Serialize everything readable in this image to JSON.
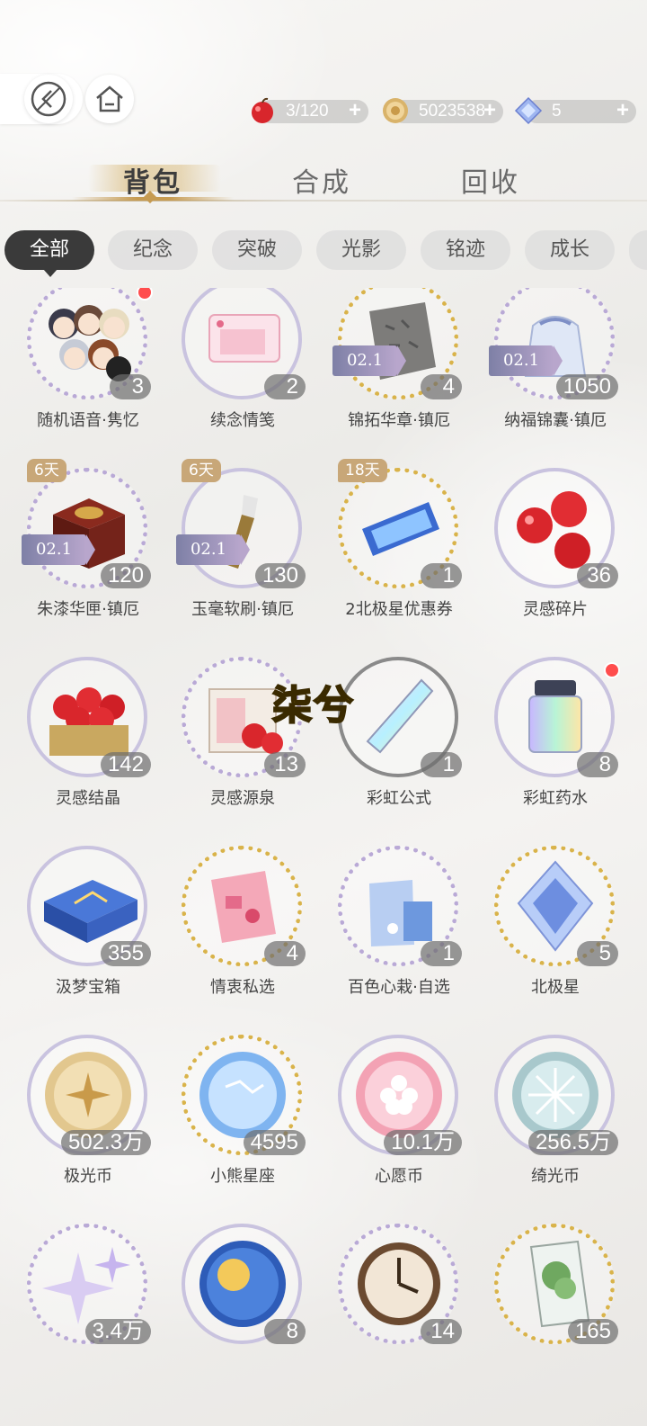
{
  "resources": {
    "apple": {
      "value": "3/120",
      "icon": "apple-icon"
    },
    "coin": {
      "value": "5023538",
      "icon": "coin-icon"
    },
    "gem": {
      "value": "5",
      "icon": "diamond-icon"
    }
  },
  "tabs": {
    "bag": "背包",
    "compose": "合成",
    "recycle": "回收"
  },
  "categories": [
    "全部",
    "纪念",
    "突破",
    "光影",
    "铭迹",
    "成长"
  ],
  "overlay_text": "柒兮",
  "ticket_label": "02.1",
  "items": [
    {
      "name": "随机语音·隽忆",
      "count": "3"
    },
    {
      "name": "续念情笺",
      "count": "2"
    },
    {
      "name": "锦拓华章·镇厄",
      "count": "4"
    },
    {
      "name": "纳福锦囊·镇厄",
      "count": "1050"
    },
    {
      "name": "朱漆华匣·镇厄",
      "count": "120",
      "days": "6天"
    },
    {
      "name": "玉毫软刷·镇厄",
      "count": "130",
      "days": "6天"
    },
    {
      "name": "2北极星优惠券",
      "count": "1",
      "days": "18天"
    },
    {
      "name": "灵感碎片",
      "count": "36"
    },
    {
      "name": "灵感结晶",
      "count": "142"
    },
    {
      "name": "灵感源泉",
      "count": "13"
    },
    {
      "name": "彩虹公式",
      "count": "1"
    },
    {
      "name": "彩虹药水",
      "count": "8"
    },
    {
      "name": "汲梦宝箱",
      "count": "355"
    },
    {
      "name": "情衷私选",
      "count": "4"
    },
    {
      "name": "百色心栽·自选",
      "count": "1"
    },
    {
      "name": "北极星",
      "count": "5"
    },
    {
      "name": "极光币",
      "count": "502.3万"
    },
    {
      "name": "小熊星座",
      "count": "4595"
    },
    {
      "name": "心愿币",
      "count": "10.1万"
    },
    {
      "name": "绮光币",
      "count": "256.5万"
    },
    {
      "name": "",
      "count": "3.4万"
    },
    {
      "name": "",
      "count": "8"
    },
    {
      "name": "",
      "count": "14"
    },
    {
      "name": "",
      "count": "165"
    }
  ]
}
